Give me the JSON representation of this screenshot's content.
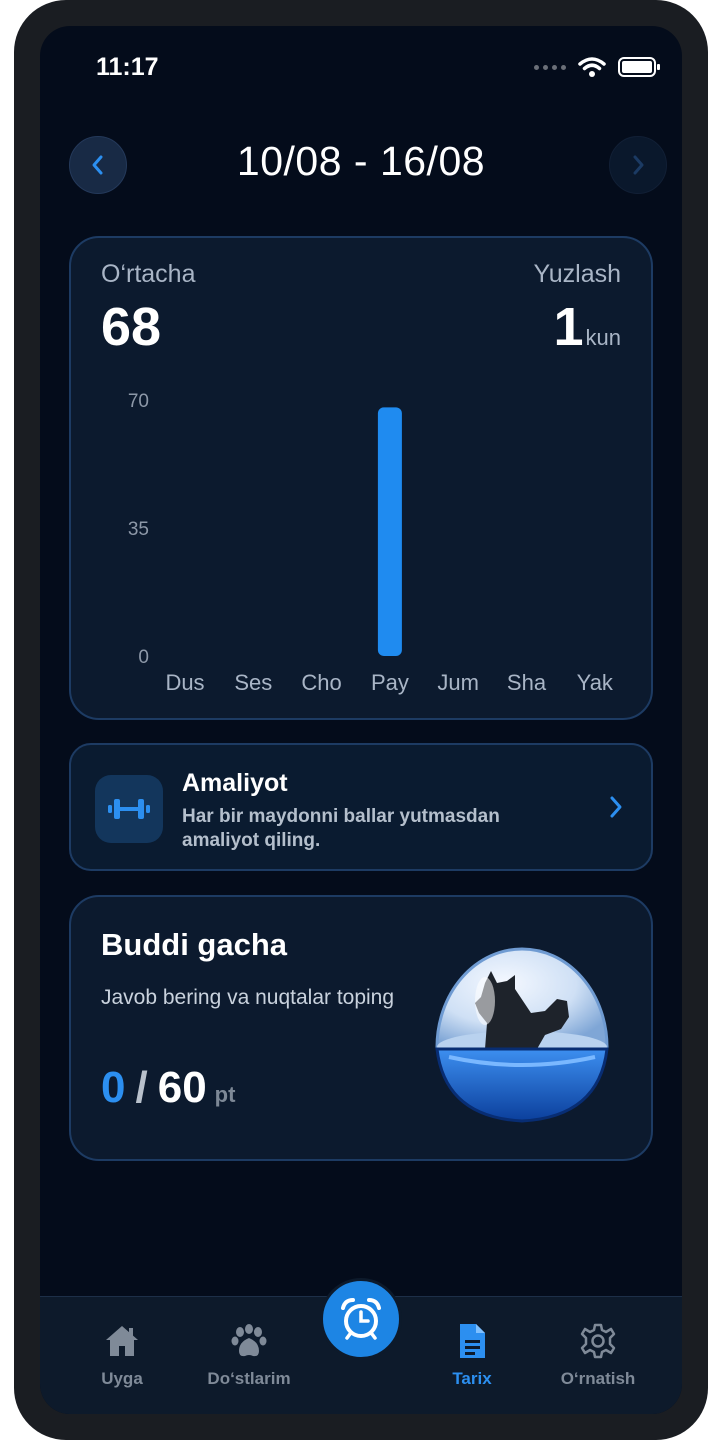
{
  "status_bar": {
    "time": "11:17"
  },
  "header": {
    "date_range": "10/08 - 16/08"
  },
  "summary": {
    "average_label": "O‘rtacha",
    "average_value": "68",
    "streak_label": "Yuzlash",
    "streak_value": "1",
    "streak_unit": "kun"
  },
  "chart_data": {
    "type": "bar",
    "categories": [
      "Dus",
      "Ses",
      "Cho",
      "Pay",
      "Jum",
      "Sha",
      "Yak"
    ],
    "values": [
      0,
      0,
      0,
      68,
      0,
      0,
      0
    ],
    "yticks": [
      "70",
      "35",
      "0"
    ],
    "ylim": [
      0,
      70
    ],
    "bar_color": "#1f8bf0"
  },
  "practice": {
    "title": "Amaliyot",
    "description": "Har bir maydonni ballar yutmasdan amaliyot qiling."
  },
  "buddy": {
    "title": "Buddi gacha",
    "description": "Javob bering va nuqtalar toping",
    "score_current": "0",
    "score_separator": "/",
    "score_max": "60",
    "score_unit": "pt"
  },
  "tabbar": {
    "items": [
      {
        "label": "Uyga",
        "icon": "home-icon"
      },
      {
        "label": "Do‘stlarim",
        "icon": "paw-icon"
      },
      {
        "label": "Tarix",
        "icon": "document-icon",
        "active": true
      },
      {
        "label": "O‘rnatish",
        "icon": "gear-icon"
      }
    ],
    "center_icon": "alarm-clock-icon"
  },
  "colors": {
    "accent": "#2c8ff0",
    "background": "#040c1b",
    "card": "#0c1a2e"
  }
}
